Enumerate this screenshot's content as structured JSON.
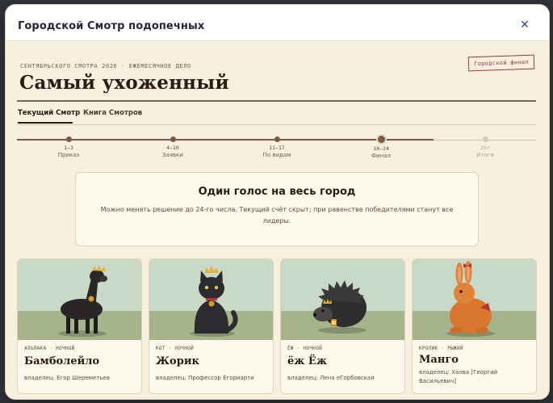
{
  "modal": {
    "title": "Городской Смотр подопечных",
    "close_icon": "✕"
  },
  "hero": {
    "kicker": "Сентябрьского смотра 2026 · ежемесячное дело",
    "stamp": "Городской финал",
    "title": "Самый ухоженный"
  },
  "tabs": [
    {
      "label": "Текущий Смотр",
      "active": true
    },
    {
      "label": "Книга Смотров",
      "active": false
    }
  ],
  "timeline": {
    "progress": 0.8,
    "steps": [
      {
        "range": "1–3",
        "label": "Приказ",
        "state": "done"
      },
      {
        "range": "4–10",
        "label": "Заявки",
        "state": "done"
      },
      {
        "range": "11–17",
        "label": "По видам",
        "state": "done"
      },
      {
        "range": "18–24",
        "label": "Финал",
        "state": "current"
      },
      {
        "range": "25+",
        "label": "Итоги",
        "state": "future"
      }
    ]
  },
  "info": {
    "title": "Один голос на весь город",
    "text": "Можно менять решение до 24-го числа. Текущий счёт скрыт; при равенстве победителями станут все лидеры."
  },
  "pets": [
    {
      "meta": "Альпака · ночной",
      "name": "Бамболейло",
      "owner": "владелец: Егор Шереметьев",
      "icon": "alpaca-with-crown"
    },
    {
      "meta": "Кот · ночной",
      "name": "Жорик",
      "owner": "владелец: Профессор Егориарти",
      "icon": "cat-with-crown"
    },
    {
      "meta": "Ёж · ночной",
      "name": "ёж Ёж",
      "owner": "владелец: Лена еГорбовская",
      "icon": "hedgehog-with-crown"
    },
    {
      "meta": "Кролик · рыжий",
      "name": "Манго",
      "owner": "владелец: Халва [Георгий Васильевич]",
      "icon": "rabbit-with-bow"
    }
  ],
  "colors": {
    "accent": "#7a5a40",
    "stamp": "#9a3b32",
    "scene_sky": "#c9d9c8",
    "scene_ground": "#a5b48a"
  }
}
